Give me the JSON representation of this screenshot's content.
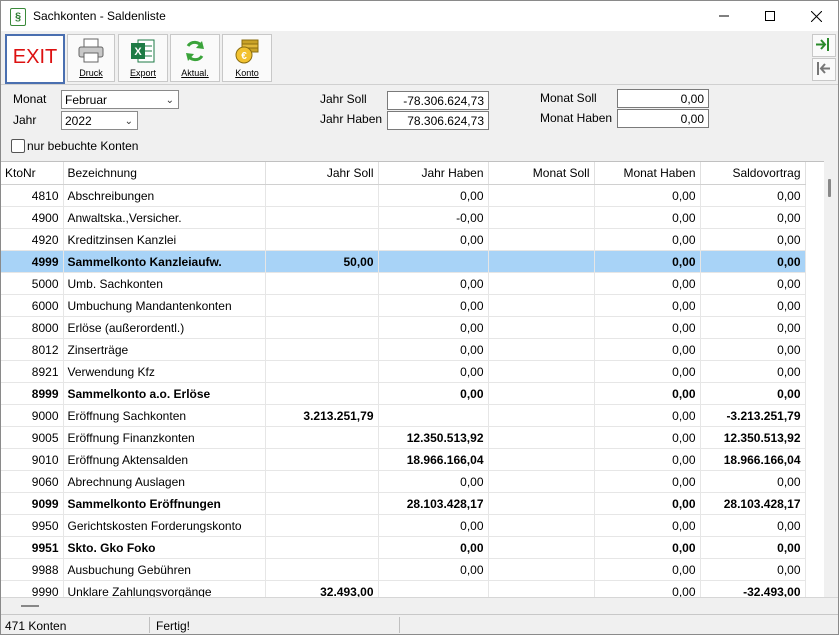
{
  "window": {
    "title": "Sachkonten - Saldenliste",
    "app_icon": "document-icon"
  },
  "toolbar": {
    "exit_label": "EXIT",
    "buttons": [
      {
        "label": "Druck",
        "icon": "printer-icon"
      },
      {
        "label": "Export",
        "icon": "excel-icon"
      },
      {
        "label": "Aktual.",
        "icon": "refresh-icon"
      },
      {
        "label": "Konto",
        "icon": "coins-icon"
      }
    ]
  },
  "filters": {
    "monat_label": "Monat",
    "monat_value": "Februar",
    "jahr_label": "Jahr",
    "jahr_value": "2022",
    "nur_bebuchte_label": "nur bebuchte Konten",
    "jahr_soll_label": "Jahr Soll",
    "jahr_soll_value": "-78.306.624,73",
    "jahr_haben_label": "Jahr Haben",
    "jahr_haben_value": "78.306.624,73",
    "monat_soll_label": "Monat Soll",
    "monat_soll_value": "0,00",
    "monat_haben_label": "Monat Haben",
    "monat_haben_value": "0,00"
  },
  "table": {
    "columns": [
      "KtoNr",
      "Bezeichnung",
      "Jahr Soll",
      "Jahr Haben",
      "Monat Soll",
      "Monat Haben",
      "Saldovortrag"
    ],
    "rows": [
      {
        "nr": "4810",
        "bez": "Abschreibungen",
        "js": "",
        "jh": "0,00",
        "ms": "",
        "mh": "0,00",
        "sv": "0,00",
        "bold": false
      },
      {
        "nr": "4900",
        "bez": "Anwaltska.,Versicher.",
        "js": "",
        "jh": "-0,00",
        "ms": "",
        "mh": "0,00",
        "sv": "0,00",
        "bold": false
      },
      {
        "nr": "4920",
        "bez": "Kreditzinsen Kanzlei",
        "js": "",
        "jh": "0,00",
        "ms": "",
        "mh": "0,00",
        "sv": "0,00",
        "bold": false
      },
      {
        "nr": "4999",
        "bez": "Sammelkonto Kanzleiaufw.",
        "js": "50,00",
        "jh": "",
        "ms": "",
        "mh": "0,00",
        "sv": "0,00",
        "bold": true,
        "selected": true
      },
      {
        "nr": "5000",
        "bez": "Umb. Sachkonten",
        "js": "",
        "jh": "0,00",
        "ms": "",
        "mh": "0,00",
        "sv": "0,00",
        "bold": false
      },
      {
        "nr": "6000",
        "bez": "Umbuchung Mandantenkonten",
        "js": "",
        "jh": "0,00",
        "ms": "",
        "mh": "0,00",
        "sv": "0,00",
        "bold": false
      },
      {
        "nr": "8000",
        "bez": "Erlöse (außerordentl.)",
        "js": "",
        "jh": "0,00",
        "ms": "",
        "mh": "0,00",
        "sv": "0,00",
        "bold": false
      },
      {
        "nr": "8012",
        "bez": "Zinserträge",
        "js": "",
        "jh": "0,00",
        "ms": "",
        "mh": "0,00",
        "sv": "0,00",
        "bold": false
      },
      {
        "nr": "8921",
        "bez": "Verwendung Kfz",
        "js": "",
        "jh": "0,00",
        "ms": "",
        "mh": "0,00",
        "sv": "0,00",
        "bold": false
      },
      {
        "nr": "8999",
        "bez": "Sammelkonto a.o. Erlöse",
        "js": "",
        "jh": "0,00",
        "ms": "",
        "mh": "0,00",
        "sv": "0,00",
        "bold": true
      },
      {
        "nr": "9000",
        "bez": "Eröffnung Sachkonten",
        "js": "3.213.251,79",
        "jh": "",
        "ms": "",
        "mh": "0,00",
        "sv": "-3.213.251,79",
        "bold": false,
        "bold_amounts": true
      },
      {
        "nr": "9005",
        "bez": "Eröffnung Finanzkonten",
        "js": "",
        "jh": "12.350.513,92",
        "ms": "",
        "mh": "0,00",
        "sv": "12.350.513,92",
        "bold": false,
        "bold_amounts": true
      },
      {
        "nr": "9010",
        "bez": "Eröffnung Aktensalden",
        "js": "",
        "jh": "18.966.166,04",
        "ms": "",
        "mh": "0,00",
        "sv": "18.966.166,04",
        "bold": false,
        "bold_amounts": true
      },
      {
        "nr": "9060",
        "bez": "Abrechnung Auslagen",
        "js": "",
        "jh": "0,00",
        "ms": "",
        "mh": "0,00",
        "sv": "0,00",
        "bold": false
      },
      {
        "nr": "9099",
        "bez": "Sammelkonto Eröffnungen",
        "js": "",
        "jh": "28.103.428,17",
        "ms": "",
        "mh": "0,00",
        "sv": "28.103.428,17",
        "bold": true
      },
      {
        "nr": "9950",
        "bez": "Gerichtskosten Forderungskonto",
        "js": "",
        "jh": "0,00",
        "ms": "",
        "mh": "0,00",
        "sv": "0,00",
        "bold": false
      },
      {
        "nr": "9951",
        "bez": "Skto. Gko Foko",
        "js": "",
        "jh": "0,00",
        "ms": "",
        "mh": "0,00",
        "sv": "0,00",
        "bold": true
      },
      {
        "nr": "9988",
        "bez": "Ausbuchung Gebühren",
        "js": "",
        "jh": "0,00",
        "ms": "",
        "mh": "0,00",
        "sv": "0,00",
        "bold": false
      },
      {
        "nr": "9990",
        "bez": "Unklare Zahlungsvorgänge",
        "js": "32.493,00",
        "jh": "",
        "ms": "",
        "mh": "0,00",
        "sv": "-32.493,00",
        "bold": false,
        "bold_amounts": true
      }
    ]
  },
  "status": {
    "count": "471 Konten",
    "state": "Fertig!"
  },
  "colors": {
    "selected_row": "#a8d3f7",
    "exit_text": "#dd1111",
    "exit_border": "#4a6fb0"
  }
}
